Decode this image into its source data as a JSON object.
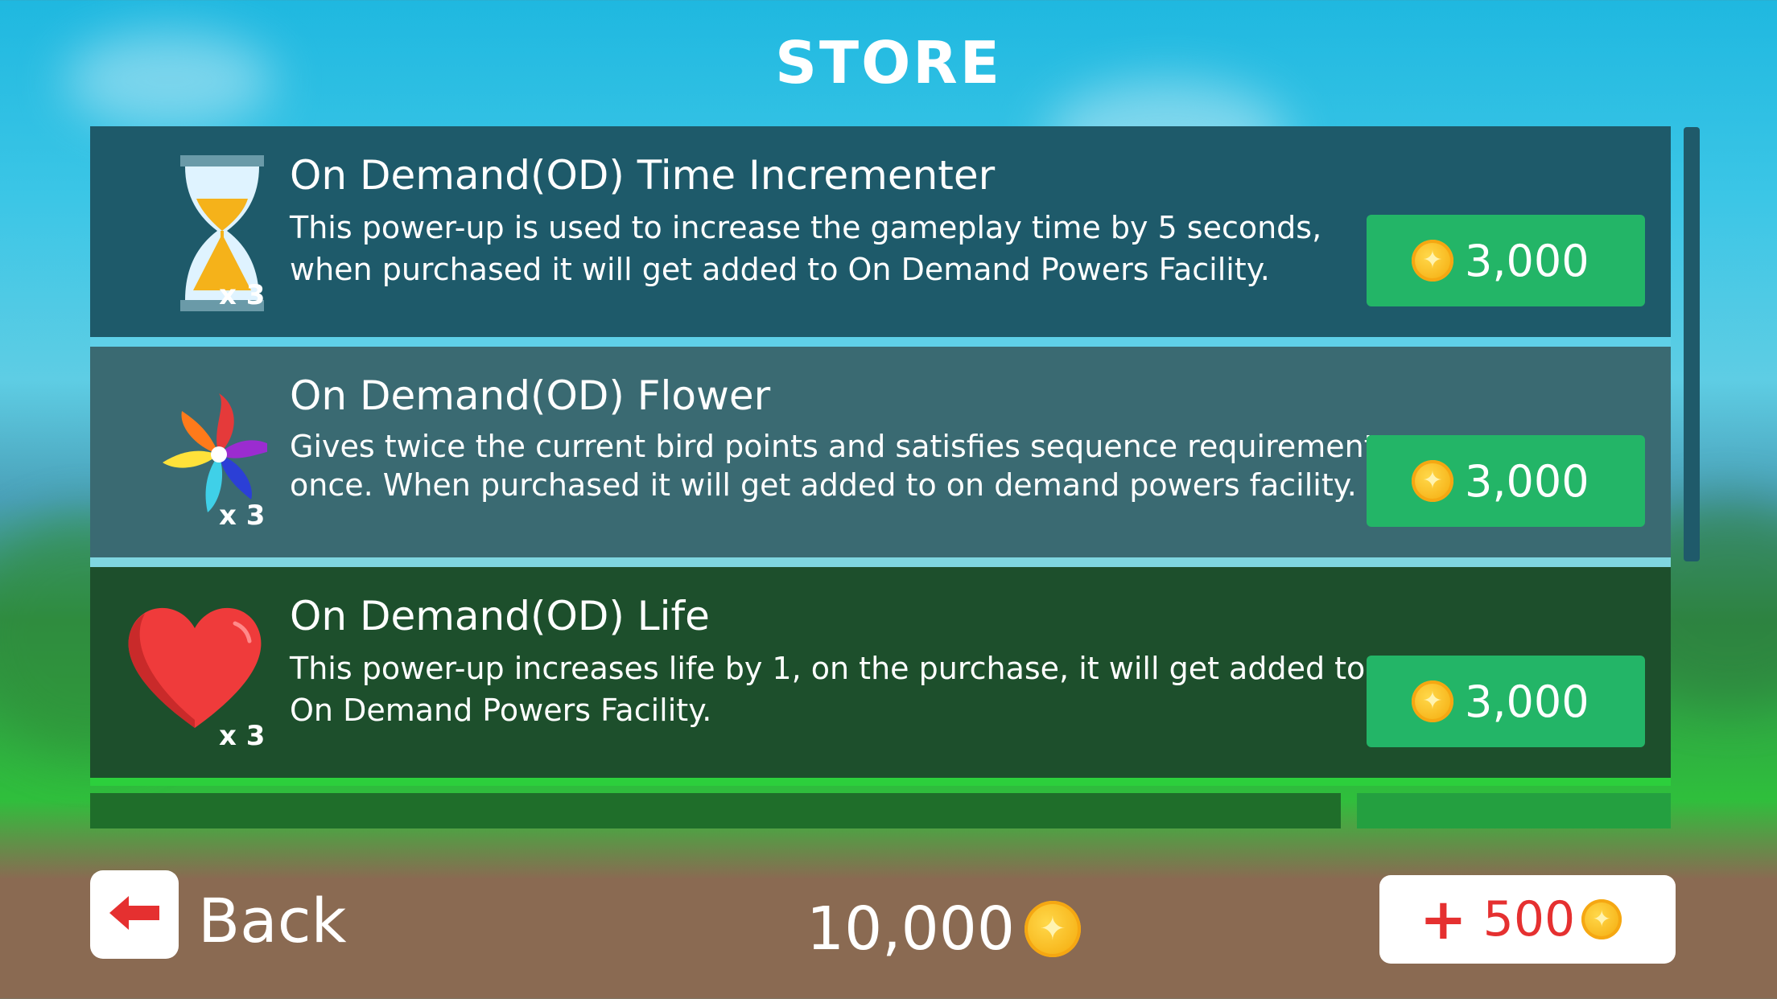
{
  "title": "STORE",
  "items": [
    {
      "name": "On Demand(OD)  Time Incrementer",
      "description": "This power-up is used to increase the gameplay time by 5 seconds, when purchased it will get added to On Demand Powers Facility.",
      "count": "x 3",
      "price": "3,000",
      "icon": "hourglass-icon"
    },
    {
      "name": "On Demand(OD)  Flower",
      "description": "Gives twice the current bird points and satisfies sequence requirement once. When purchased it will get added to on demand powers facility.",
      "count": "x 3",
      "price": "3,000",
      "icon": "flower-icon"
    },
    {
      "name": "On Demand(OD)  Life",
      "description": "This power-up increases life by 1, on the purchase, it will get added to On Demand Powers Facility.",
      "count": "x 3",
      "price": "3,000",
      "icon": "heart-icon"
    }
  ],
  "footer": {
    "back_label": "Back",
    "balance": "10,000",
    "add_coins_value": "500"
  },
  "colors": {
    "price_button": "#23b567",
    "row_teal": "#1e5e6e",
    "row_green": "#1f5a2c",
    "accent_red": "#e53030",
    "coin_gold": "#f7b51a"
  }
}
